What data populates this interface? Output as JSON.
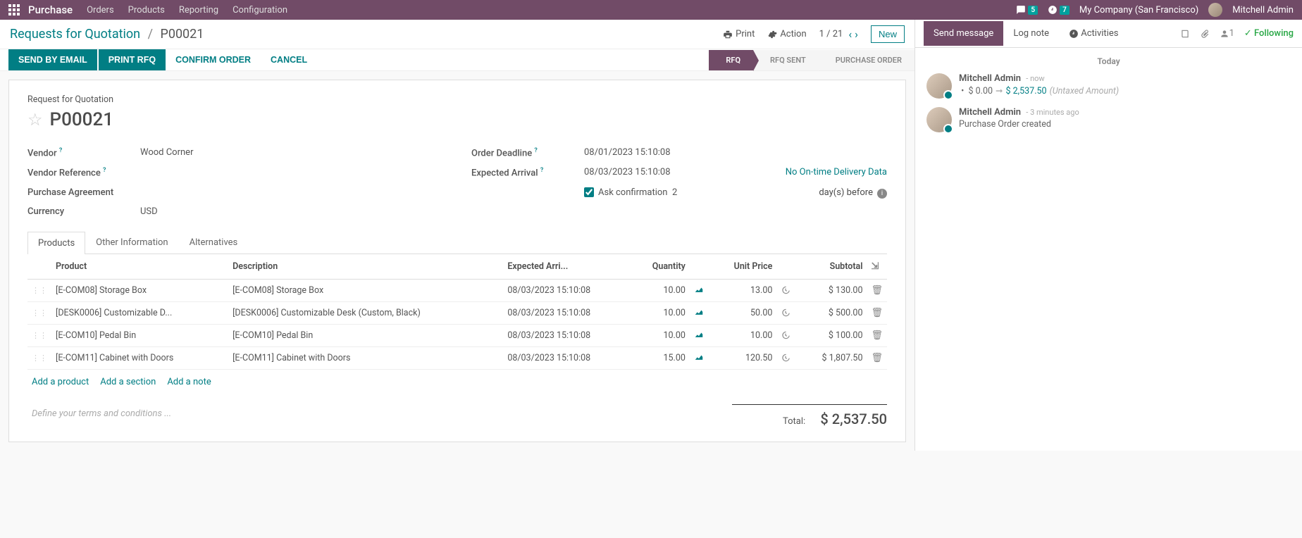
{
  "topbar": {
    "brand": "Purchase",
    "menu": [
      "Orders",
      "Products",
      "Reporting",
      "Configuration"
    ],
    "discuss_badge": "5",
    "activity_badge": "7",
    "company": "My Company (San Francisco)",
    "user": "Mitchell Admin"
  },
  "breadcrumb": {
    "root": "Requests for Quotation",
    "current": "P00021",
    "print": "Print",
    "action": "Action",
    "pager": "1 / 21",
    "new": "New"
  },
  "actions": {
    "send_email": "SEND BY EMAIL",
    "print_rfq": "PRINT RFQ",
    "confirm": "CONFIRM ORDER",
    "cancel": "CANCEL"
  },
  "status_steps": [
    "RFQ",
    "RFQ SENT",
    "PURCHASE ORDER"
  ],
  "record": {
    "title_label": "Request for Quotation",
    "name": "P00021",
    "vendor_label": "Vendor",
    "vendor": "Wood Corner",
    "vendor_ref_label": "Vendor Reference",
    "agreement_label": "Purchase Agreement",
    "currency_label": "Currency",
    "currency": "USD",
    "deadline_label": "Order Deadline",
    "deadline": "08/01/2023 15:10:08",
    "arrival_label": "Expected Arrival",
    "arrival": "08/03/2023 15:10:08",
    "arrival_extra": "No On-time Delivery Data",
    "ask_conf_label": "Ask confirmation",
    "ask_conf_days": "2",
    "days_before": "day(s) before"
  },
  "tabs": [
    "Products",
    "Other Information",
    "Alternatives"
  ],
  "columns": {
    "product": "Product",
    "description": "Description",
    "expected": "Expected Arri...",
    "quantity": "Quantity",
    "unit_price": "Unit Price",
    "subtotal": "Subtotal"
  },
  "lines": [
    {
      "product": "[E-COM08] Storage Box",
      "desc": "[E-COM08] Storage Box",
      "date": "08/03/2023 15:10:08",
      "qty": "10.00",
      "price": "13.00",
      "subtotal": "$ 130.00"
    },
    {
      "product": "[DESK0006] Customizable D...",
      "desc": "[DESK0006] Customizable Desk (Custom, Black)",
      "date": "08/03/2023 15:10:08",
      "qty": "10.00",
      "price": "50.00",
      "subtotal": "$ 500.00"
    },
    {
      "product": "[E-COM10] Pedal Bin",
      "desc": "[E-COM10] Pedal Bin",
      "date": "08/03/2023 15:10:08",
      "qty": "10.00",
      "price": "10.00",
      "subtotal": "$ 100.00"
    },
    {
      "product": "[E-COM11] Cabinet with Doors",
      "desc": "[E-COM11] Cabinet with Doors",
      "date": "08/03/2023 15:10:08",
      "qty": "15.00",
      "price": "120.50",
      "subtotal": "$ 1,807.50"
    }
  ],
  "add_links": {
    "product": "Add a product",
    "section": "Add a section",
    "note": "Add a note"
  },
  "terms_placeholder": "Define your terms and conditions ...",
  "totals": {
    "label": "Total:",
    "amount": "$ 2,537.50"
  },
  "chatter": {
    "send": "Send message",
    "log": "Log note",
    "activities": "Activities",
    "followers": "1",
    "following": "Following",
    "date_sep": "Today",
    "msgs": [
      {
        "who": "Mitchell Admin",
        "when": "now",
        "old": "$ 0.00",
        "new": "$ 2,537.50",
        "note": "(Untaxed Amount)"
      },
      {
        "who": "Mitchell Admin",
        "when": "3 minutes ago",
        "text": "Purchase Order created"
      }
    ]
  }
}
